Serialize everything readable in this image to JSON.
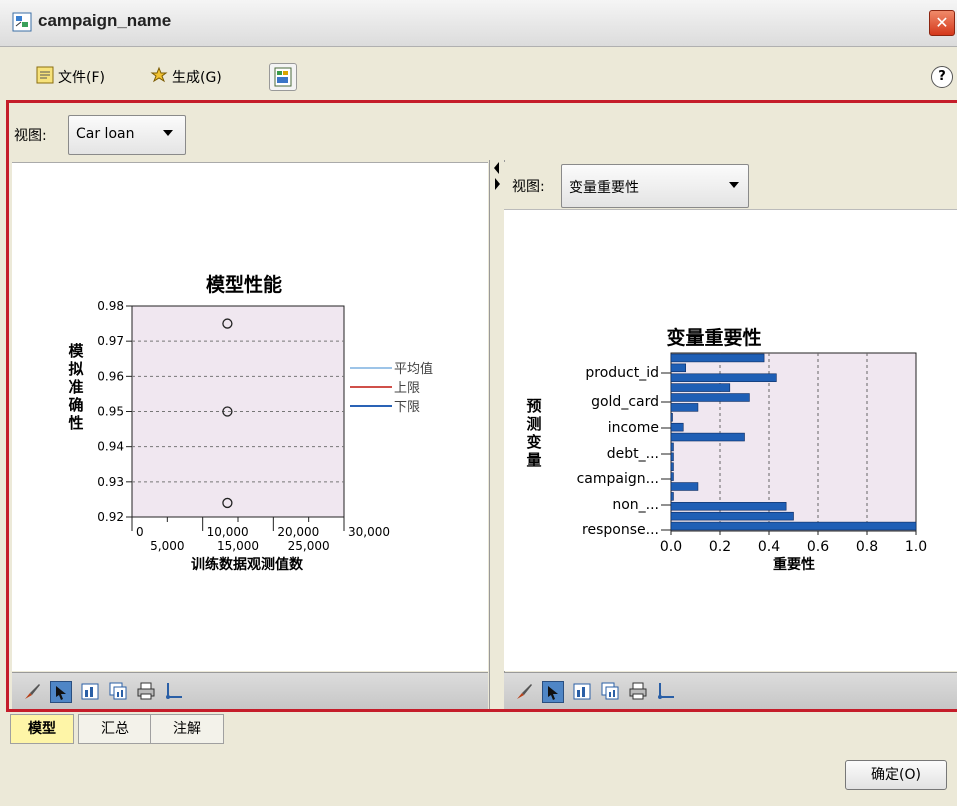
{
  "window": {
    "title": "campaign_name",
    "close_label": "✕"
  },
  "menu": {
    "file_label": "文件(F)",
    "generate_label": "生成(G)",
    "help_label": "?"
  },
  "view": {
    "label": "视图:",
    "selected": "Car loan"
  },
  "right_view": {
    "label": "视图:",
    "selected": "变量重要性"
  },
  "tabs": [
    {
      "label": "模型",
      "active": true
    },
    {
      "label": "汇总",
      "active": false
    },
    {
      "label": "注解",
      "active": false
    }
  ],
  "ok_label": "确定(O)",
  "colors": {
    "accent_red": "#c51d2a",
    "plot_bg": "#f0e7f0",
    "bar": "#1f5fb5"
  },
  "chart_data": [
    {
      "type": "scatter",
      "title": "模型性能",
      "xlabel": "训练数据观测值数",
      "ylabel": "模拟准确性",
      "xlim": [
        0,
        30000
      ],
      "ylim": [
        0.92,
        0.98
      ],
      "x_ticks_top": [
        "0",
        "10,000",
        "20,000",
        "30,000"
      ],
      "x_ticks_bottom": [
        "5,000",
        "15,000",
        "25,000"
      ],
      "y_ticks": [
        "0.98",
        "0.97",
        "0.96",
        "0.95",
        "0.94",
        "0.93",
        "0.92"
      ],
      "points": [
        {
          "x": 13500,
          "y": 0.975
        },
        {
          "x": 13500,
          "y": 0.95
        },
        {
          "x": 13500,
          "y": 0.924
        }
      ],
      "legend": [
        {
          "name": "平均值",
          "color": "#9dc4e8"
        },
        {
          "name": "上限",
          "color": "#d0504a"
        },
        {
          "name": "下限",
          "color": "#2a63b6"
        }
      ],
      "grid": true,
      "legend_placement": "right"
    },
    {
      "type": "bar",
      "orientation": "horizontal",
      "title": "变量重要性",
      "xlabel": "重要性",
      "ylabel": "预测变量",
      "xlim": [
        0,
        1.0
      ],
      "x_ticks": [
        "0.0",
        "0.2",
        "0.4",
        "0.6",
        "0.8",
        "1.0"
      ],
      "category_labels": [
        "product_id",
        "gold_card",
        "income",
        "debt_...",
        "campaign...",
        "non_...",
        "response..."
      ],
      "values": [
        0.38,
        0.06,
        0.43,
        0.24,
        0.32,
        0.11,
        0.0,
        0.05,
        0.3,
        0.01,
        0.01,
        0.01,
        0.01,
        0.11,
        0.01,
        0.47,
        0.5,
        1.0
      ],
      "grid": true
    }
  ]
}
